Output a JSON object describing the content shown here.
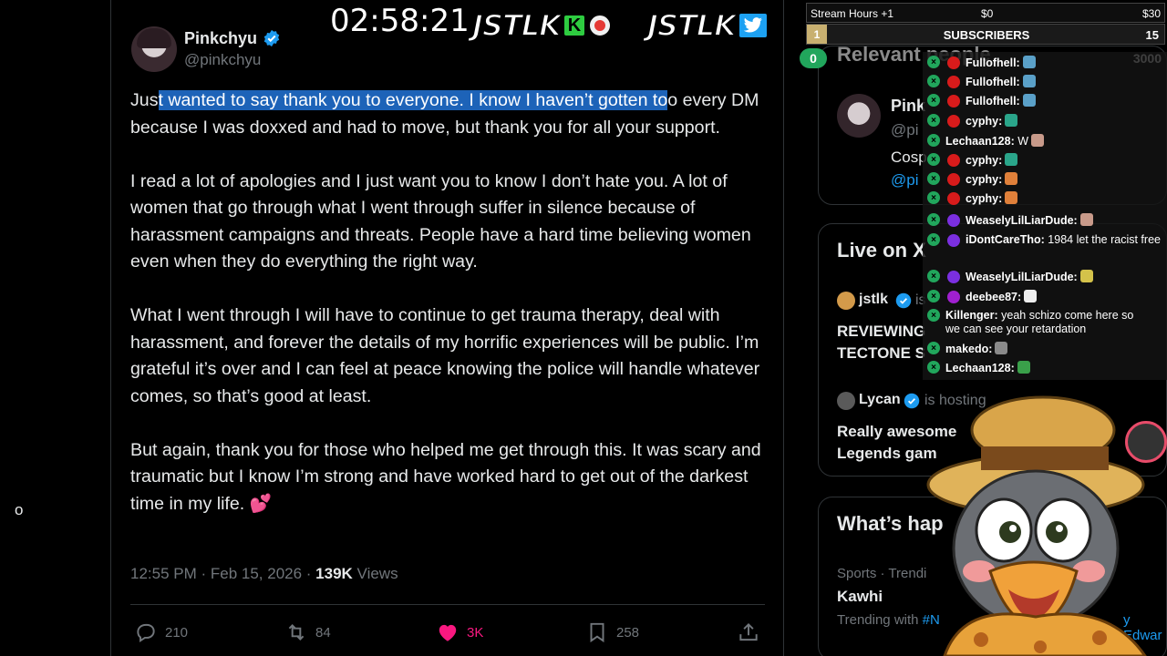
{
  "left_column": {
    "stray_char": "o"
  },
  "tweet": {
    "author_name": "Pinkchyu",
    "author_handle": "@pinkchyu",
    "text": {
      "p1_pre": "Jus",
      "p1_selected": "t wanted to say thank you to everyone. I know I haven’t gotten to",
      "p1_post": "o every DM because I was doxxed and had to move, but thank you for all your support.",
      "p1_sel_end_char": "t",
      "p2": "I read a lot of apologies and I just want you to know I don’t hate you. A lot of women that go through what I went through suffer in silence because of harassment campaigns and threats. People have a hard time believing women even when they do everything the right way.",
      "p3": "What I went through I will have to continue to get trauma therapy, deal with harassment, and forever the details of my horrific experiences will be public. I’m grateful it’s over and I can feel at peace knowing the police will handle whatever comes, so that’s good at least.",
      "p4": "But again, thank you for those who helped me get through this. It was scary and traumatic but I know I’m strong and have worked hard to get out of the darkest time in my life.",
      "p4_emoji": "💕"
    },
    "timestamp": "12:55 PM · Feb 15, 2026 · ",
    "views_count": "139K",
    "views_label": " Views",
    "actions": {
      "replies": "210",
      "reposts": "84",
      "likes": "3K",
      "bookmarks": "258"
    }
  },
  "overlay": {
    "timer": "02:58:21",
    "logo_text": "JSTLK",
    "kick_letter": "K"
  },
  "stats": {
    "label": "Stream Hours +1",
    "mid": "$0",
    "right": "$30",
    "rank": "1",
    "subscribers_label": "SUBSCRIBERS",
    "subscribers_count": "15",
    "goal_current": "0",
    "goal_target": "3000"
  },
  "sidebar": {
    "relevant_title": "Relevant people",
    "person_name": "Pink",
    "person_handle": "@pi",
    "person_bio": "Cosp",
    "person_link": "@pi",
    "live_title": "Live on X",
    "live1_name": "jstlk",
    "live1_status": "is",
    "live1_title": "REVIEWING TECTONE S",
    "live2_name": "Lycan",
    "live2_status": "is hosting",
    "live2_title": "Really awesome Legends gam",
    "happening_title": "What’s hap",
    "trend_category": "Sports · Trendi",
    "trend_topic": "Kawhi",
    "trend_with": "Trending with ",
    "trend_tag": "#N",
    "trend_end": "y Edwar"
  },
  "chat": [
    {
      "name": "Fullofhell:",
      "msg": "",
      "dot": "#d81b1b"
    },
    {
      "name": "Fullofhell:",
      "msg": "",
      "dot": "#d81b1b"
    },
    {
      "name": "Fullofhell:",
      "msg": "",
      "dot": "#d81b1b"
    },
    {
      "name": "cyphy:",
      "msg": "",
      "dot": "#d81b1b"
    },
    {
      "name": "Lechaan128:",
      "msg": "W",
      "dot": ""
    },
    {
      "name": "cyphy:",
      "msg": "",
      "dot": "#d81b1b"
    },
    {
      "name": "cyphy:",
      "msg": "",
      "dot": "#d81b1b"
    },
    {
      "name": "cyphy:",
      "msg": "",
      "dot": "#d81b1b"
    },
    {
      "name": "WeaselyLilLiarDude:",
      "msg": "",
      "dot": "#7b2fe0"
    },
    {
      "name": "iDontCareTho:",
      "msg": "1984 let the racist free",
      "dot": "#7b2fe0"
    },
    {
      "name": "WeaselyLilLiarDude:",
      "msg": "",
      "dot": "#7b2fe0"
    },
    {
      "name": "deebee87:",
      "msg": "",
      "dot": "#a020d0"
    },
    {
      "name": "Killenger:",
      "msg": "yeah schizo come here so we can see your retardation",
      "dot": ""
    },
    {
      "name": "makedo:",
      "msg": "",
      "dot": ""
    },
    {
      "name": "Lechaan128:",
      "msg": "",
      "dot": ""
    }
  ],
  "colors": {
    "accent_blue": "#1d9bf0",
    "like_pink": "#f91880",
    "selection_blue": "#1d63b8",
    "chat_green": "#21a65c"
  }
}
